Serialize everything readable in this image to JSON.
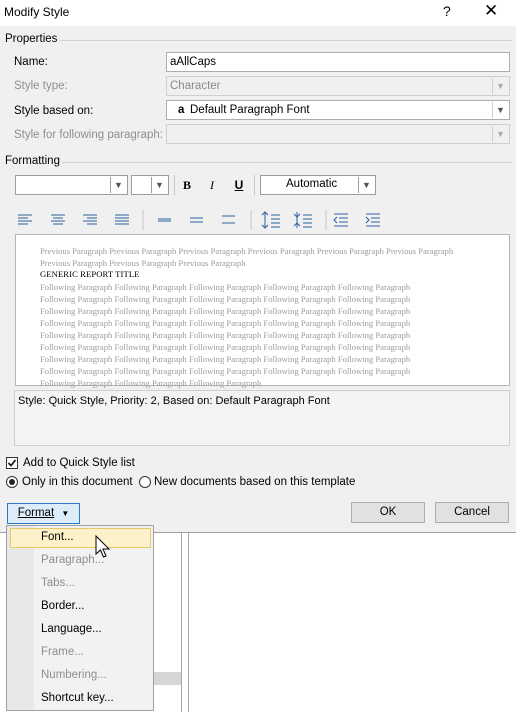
{
  "window": {
    "title": "Modify Style",
    "help": "?",
    "close": "✕"
  },
  "properties": {
    "group_label": "Properties",
    "name_label": "Name:",
    "name_value": "aAllCaps",
    "style_type_label": "Style type:",
    "style_type_value": "Character",
    "based_on_label": "Style based on:",
    "based_on_icon": "a",
    "based_on_value": "Default Paragraph Font",
    "following_label": "Style for following paragraph:",
    "following_value": ""
  },
  "formatting": {
    "group_label": "Formatting",
    "font_value": "",
    "size_value": "",
    "bold": "B",
    "italic": "I",
    "underline": "U",
    "color_value": "Automatic"
  },
  "preview": {
    "prev_text": "Previous Paragraph Previous Paragraph Previous Paragraph Previous Paragraph Previous Paragraph Previous Paragraph Previous Paragraph Previous Paragraph Previous Paragraph",
    "sample_text": "GENERIC REPORT TITLE",
    "following_lines": [
      "Following Paragraph Following Paragraph Following Paragraph Following Paragraph Following Paragraph",
      "Following Paragraph Following Paragraph Following Paragraph Following Paragraph Following Paragraph",
      "Following Paragraph Following Paragraph Following Paragraph Following Paragraph Following Paragraph",
      "Following Paragraph Following Paragraph Following Paragraph Following Paragraph Following Paragraph",
      "Following Paragraph Following Paragraph Following Paragraph Following Paragraph Following Paragraph",
      "Following Paragraph Following Paragraph Following Paragraph Following Paragraph Following Paragraph",
      "Following Paragraph Following Paragraph Following Paragraph Following Paragraph Following Paragraph",
      "Following Paragraph Following Paragraph Following Paragraph Following Paragraph Following Paragraph",
      "Following Paragraph Following Paragraph Following Paragraph"
    ]
  },
  "description": "Style: Quick Style, Priority: 2, Based on: Default Paragraph Font",
  "options": {
    "add_quick_style_label": "Add to Quick Style list",
    "add_quick_style_checked": true,
    "only_this_doc_label": "Only in this document",
    "new_docs_label": "New documents based on this template",
    "selected": "only_this_doc"
  },
  "buttons": {
    "format": "Format",
    "ok": "OK",
    "cancel": "Cancel"
  },
  "format_menu": {
    "items": [
      {
        "label": "Font...",
        "enabled": true,
        "highlighted": true
      },
      {
        "label": "Paragraph...",
        "enabled": false
      },
      {
        "label": "Tabs...",
        "enabled": false
      },
      {
        "label": "Border...",
        "enabled": true
      },
      {
        "label": "Language...",
        "enabled": true
      },
      {
        "label": "Frame...",
        "enabled": false
      },
      {
        "label": "Numbering...",
        "enabled": false
      },
      {
        "label": "Shortcut key...",
        "enabled": true
      }
    ]
  }
}
